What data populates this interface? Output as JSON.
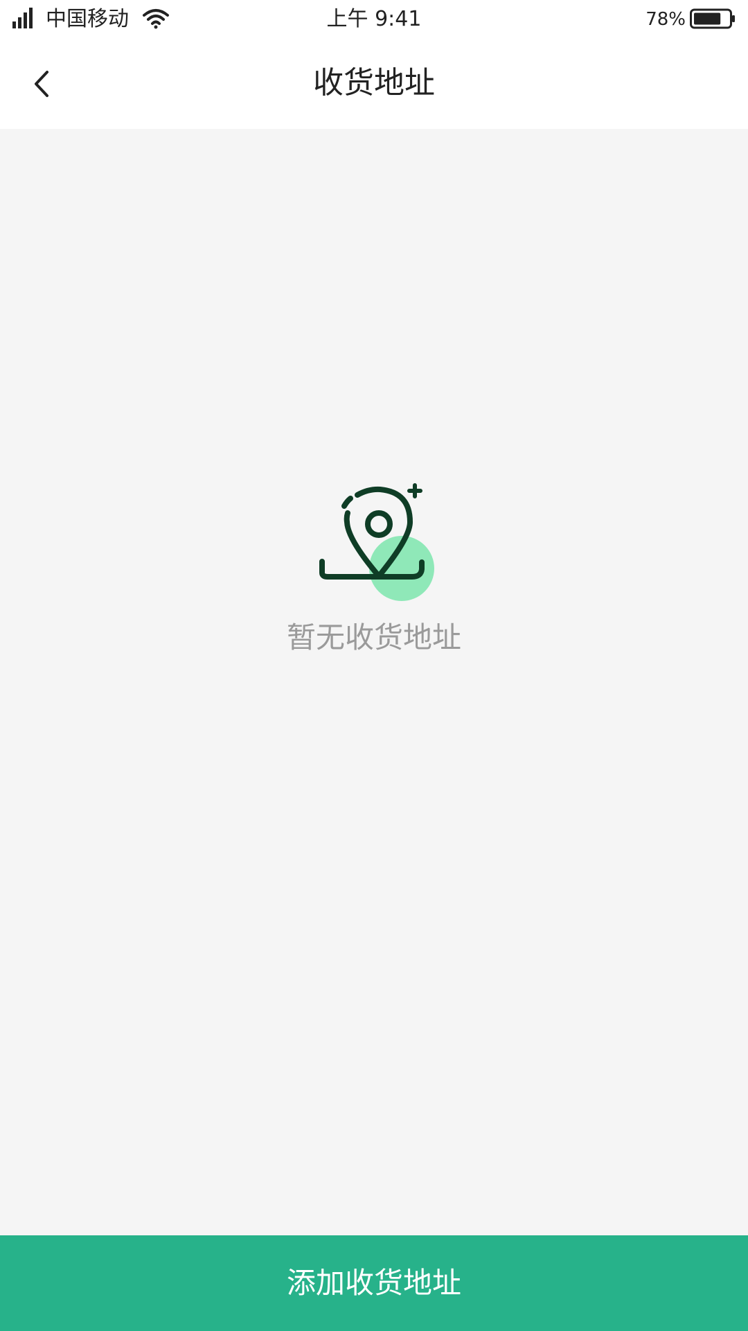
{
  "status_bar": {
    "carrier": "中国移动",
    "time": "上午 9:41",
    "battery_percent": "78%",
    "battery_level": 0.78,
    "icons": [
      "signal-icon",
      "wifi-icon",
      "battery-icon"
    ]
  },
  "nav": {
    "title": "收货地址",
    "back_icon": "chevron-left-icon"
  },
  "empty_state": {
    "icon": "location-pin-icon",
    "message": "暂无收货地址"
  },
  "footer": {
    "add_button_label": "添加收货地址"
  },
  "colors": {
    "accent": "#27b28a",
    "icon_dark": "#0f3d26",
    "icon_highlight": "#8fe8b8",
    "background": "#f5f5f5",
    "muted_text": "#9a9a9a"
  }
}
